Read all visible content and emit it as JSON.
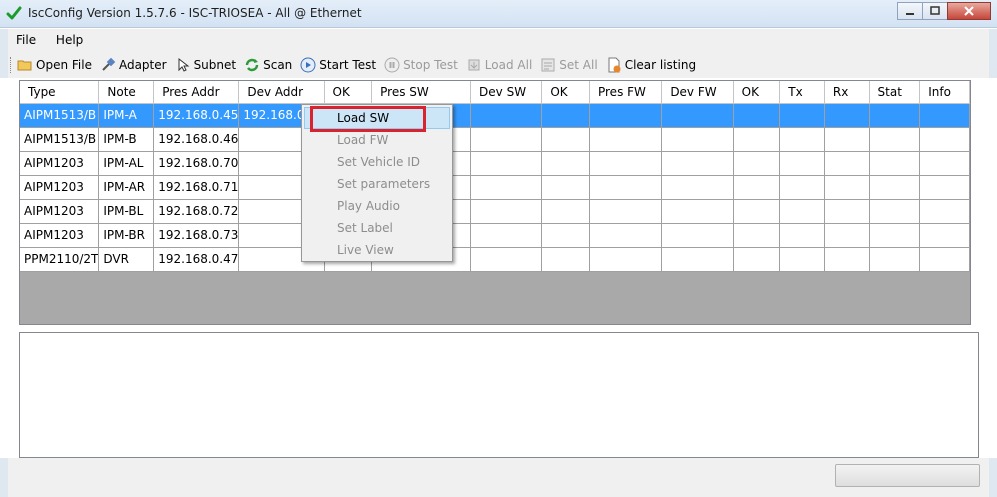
{
  "window": {
    "title": "IscConfig Version 1.5.7.6 - ISC-TRIOSEA - All @ Ethernet",
    "icon": "green-checkmark-icon"
  },
  "menu": {
    "items": [
      "File",
      "Help"
    ]
  },
  "toolbar": {
    "open_file": "Open File",
    "adapter": "Adapter",
    "subnet": "Subnet",
    "scan": "Scan",
    "start_test": "Start Test",
    "stop_test": "Stop Test",
    "load_all": "Load All",
    "set_all": "Set All",
    "clear_listing": "Clear listing"
  },
  "grid": {
    "columns": [
      "Type",
      "Note",
      "Pres Addr",
      "Dev Addr",
      "OK",
      "Pres SW",
      "Dev SW",
      "OK",
      "Pres FW",
      "Dev FW",
      "OK",
      "Tx",
      "Rx",
      "Stat",
      "Info"
    ],
    "rows": [
      [
        "AIPM1513/B",
        "IPM-A",
        "192.168.0.45",
        "192.168.0.45"
      ],
      [
        "AIPM1513/B",
        "IPM-B",
        "192.168.0.46",
        ""
      ],
      [
        "AIPM1203",
        "IPM-AL",
        "192.168.0.70",
        ""
      ],
      [
        "AIPM1203",
        "IPM-AR",
        "192.168.0.71",
        ""
      ],
      [
        "AIPM1203",
        "IPM-BL",
        "192.168.0.72",
        ""
      ],
      [
        "AIPM1203",
        "IPM-BR",
        "192.168.0.73",
        ""
      ],
      [
        "PPM2110/2T",
        "DVR",
        "192.168.0.47",
        ""
      ]
    ],
    "selected_row": 0
  },
  "context_menu": {
    "items": [
      "Load SW",
      "Load FW",
      "Set Vehicle ID",
      "Set parameters",
      "Play Audio",
      "Set Label",
      "Live View"
    ],
    "active_item": "Load SW",
    "highlight_color": "#d9232e"
  },
  "colors": {
    "selection": "#3399ff",
    "grid_background": "#a9a9a9"
  }
}
